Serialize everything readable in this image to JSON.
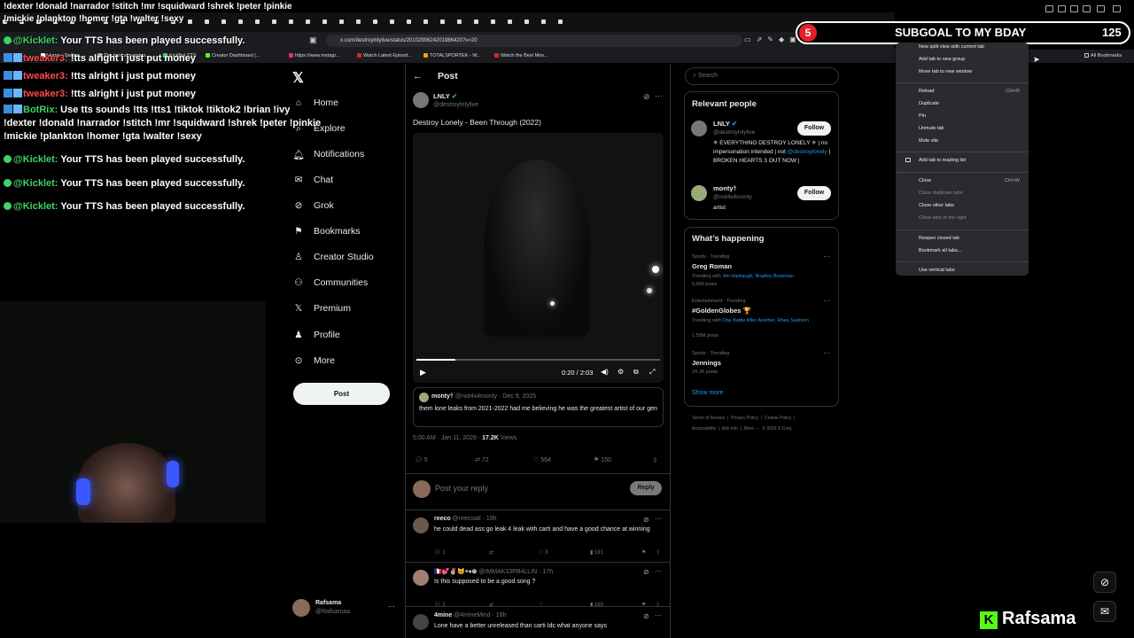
{
  "browser": {
    "tabs_count": 34,
    "url": "x.com/destroylnlylive/status/2010290624201986420?s=20",
    "bookmarks": [
      "Home - Twitter",
      "The best streaming...",
      "KickBot TTS",
      "Creator Dashboard |...",
      "https://www.instagr...",
      "Watch Latest Episod...",
      "TOTALSPORTEK - W...",
      "Watch the Best Mov..."
    ],
    "all_bookmarks": "All Bookmarks"
  },
  "subgoal": {
    "count": "5",
    "label": "SUBGOAL TO MY BDAY",
    "value": "125"
  },
  "context_menu": {
    "items": [
      {
        "label": "New split view with current tab",
        "shortcut": "",
        "disabled": false
      },
      {
        "label": "Add tab to new group",
        "shortcut": "",
        "disabled": false
      },
      {
        "label": "Move tab to new window",
        "shortcut": "",
        "disabled": false
      },
      {
        "label": "Reload",
        "shortcut": "Ctrl+R",
        "disabled": false
      },
      {
        "label": "Duplicate",
        "shortcut": "",
        "disabled": false
      },
      {
        "label": "Pin",
        "shortcut": "",
        "disabled": false
      },
      {
        "label": "Unmute tab",
        "shortcut": "",
        "disabled": false
      },
      {
        "label": "Mute site",
        "shortcut": "",
        "disabled": false
      },
      {
        "label": "Add tab to reading list",
        "shortcut": "",
        "disabled": false
      },
      {
        "label": "Close",
        "shortcut": "Ctrl+W",
        "disabled": false
      },
      {
        "label": "Close duplicate tabs",
        "shortcut": "",
        "disabled": true
      },
      {
        "label": "Close other tabs",
        "shortcut": "",
        "disabled": false
      },
      {
        "label": "Close tabs to the right",
        "shortcut": "",
        "disabled": true
      },
      {
        "label": "Reopen closed tab",
        "shortcut": "",
        "disabled": false
      },
      {
        "label": "Bookmark all tabs...",
        "shortcut": "",
        "disabled": false
      },
      {
        "label": "Use vertical tabs",
        "shortcut": "",
        "disabled": false
      }
    ]
  },
  "chat": {
    "top_line1": "!dexter !donald !narrador !stitch !mr !squidward !shrek !peter !pinkie",
    "top_line2": "!mickie !plankton !homer !gta !walter !sexy",
    "messages": [
      {
        "user": "@Kicklet:",
        "text": "Your TTS has been played successfully."
      },
      {
        "user": "tweaker3:",
        "text": "!tts alright i just put money"
      },
      {
        "user": "tweaker3:",
        "text": "!tts alright i just put money"
      },
      {
        "user": "tweaker3:",
        "text": "!tts alright i just put money"
      },
      {
        "user": "BotRix:",
        "text": "Use tts sounds !tts !tts1 !tiktok !tiktok2 !brian !ivy"
      },
      {
        "user": "",
        "text": "!dexter !donald !narrador !stitch !mr !squidward !shrek !peter !pinkie"
      },
      {
        "user": "",
        "text": "!mickie !plankton !homer !gta !walter !sexy"
      },
      {
        "user": "@Kicklet:",
        "text": "Your TTS has been played successfully."
      },
      {
        "user": "@Kicklet:",
        "text": "Your TTS has been played successfully."
      },
      {
        "user": "@Kicklet:",
        "text": "Your TTS has been played successfully."
      }
    ]
  },
  "x_nav": {
    "items": [
      "Home",
      "Explore",
      "Notifications",
      "Chat",
      "Grok",
      "Bookmarks",
      "Creator Studio",
      "Communities",
      "Premium",
      "Profile",
      "More"
    ],
    "post_button": "Post",
    "account_name": "Rafsama",
    "account_handle": "@Rafsamaa"
  },
  "post": {
    "header": "Post",
    "author_name": "LNLY",
    "author_handle": "@destroylnlylive",
    "text": "Destroy Lonely - Been Through (2022)",
    "video_time": "0:20 / 2:03",
    "quote": {
      "name": "monty†",
      "handle": "@not4x4monty",
      "date": "Dec 9, 2025",
      "text": "them lone leaks from 2021-2022 had me believing he was the greatest artist of our gen"
    },
    "timestamp": "5:00 AM · Jan 11, 2026 ·",
    "views": "17.2K",
    "views_label": "Views",
    "replies": "5",
    "reposts": "72",
    "likes": "564",
    "bookmarks": "150",
    "reply_placeholder": "Post your reply",
    "reply_button": "Reply"
  },
  "replies": [
    {
      "name": "reeco",
      "handle": "@reecoatl · 19h",
      "text": "he could dead ass go leak 4 leak with carti and have a good chance at winning",
      "replies": "1",
      "likes": "3",
      "views": "191"
    },
    {
      "name": "🇫🇷💕✌🏼😺+♦⊗",
      "handle": "@IMMAK33PB4LLIN · 17h",
      "text": "Is this supposed to be a good song ?",
      "replies": "2",
      "likes": "",
      "views": "160"
    },
    {
      "name": "4mine",
      "handle": "@4mineMind · 16h",
      "text": "Lone have a better unreleased than carti Idc what anyone says",
      "replies": "",
      "likes": "",
      "views": ""
    }
  ],
  "right": {
    "search_placeholder": "Search",
    "relevant_title": "Relevant people",
    "people": [
      {
        "name": "LNLY",
        "handle": "@destroylnlylive",
        "bio_pre": "✳ EVERYTHING DESTROY LONELY ✳ | no impersonation intended | not",
        "bio_link": "@destroylonely",
        "bio_post": "| BROKEN HEARTS 3 OUT NOW |",
        "follow": "Follow"
      },
      {
        "name": "monty†",
        "handle": "@not4x4monty",
        "bio_pre": "artist",
        "bio_link": "",
        "bio_post": "",
        "follow": "Follow"
      }
    ],
    "happening_title": "What’s happening",
    "trends": [
      {
        "meta": "Sports · Trending",
        "name": "Greg Roman",
        "with_label": "Trending with",
        "with": "Jim Harbaugh, Bradley Bozeman",
        "posts": "9,665 posts"
      },
      {
        "meta": "Entertainment · Trending",
        "name": "#GoldenGlobes 🏆",
        "with_label": "Trending with",
        "with": "One Battle After Another, Rhea Seehorn",
        "posts": "1.59M posts"
      },
      {
        "meta": "Sports · Trending",
        "name": "Jennings",
        "with_label": "",
        "with": "",
        "posts": "24.1K posts"
      }
    ],
    "show_more": "Show more",
    "footer_line1": "Terms of Service  |  Privacy Policy  |  Cookie Policy  |",
    "footer_line2": "Accessibility  |  Ads info  |  More ···  © 2026 X Corp."
  },
  "stream_brand": "Rafsama",
  "colors": {
    "accent": "#1d9bf0",
    "chat_green": "#3fd26a",
    "chat_red": "#ff4b4b",
    "subgoal_red": "#e3202a"
  }
}
